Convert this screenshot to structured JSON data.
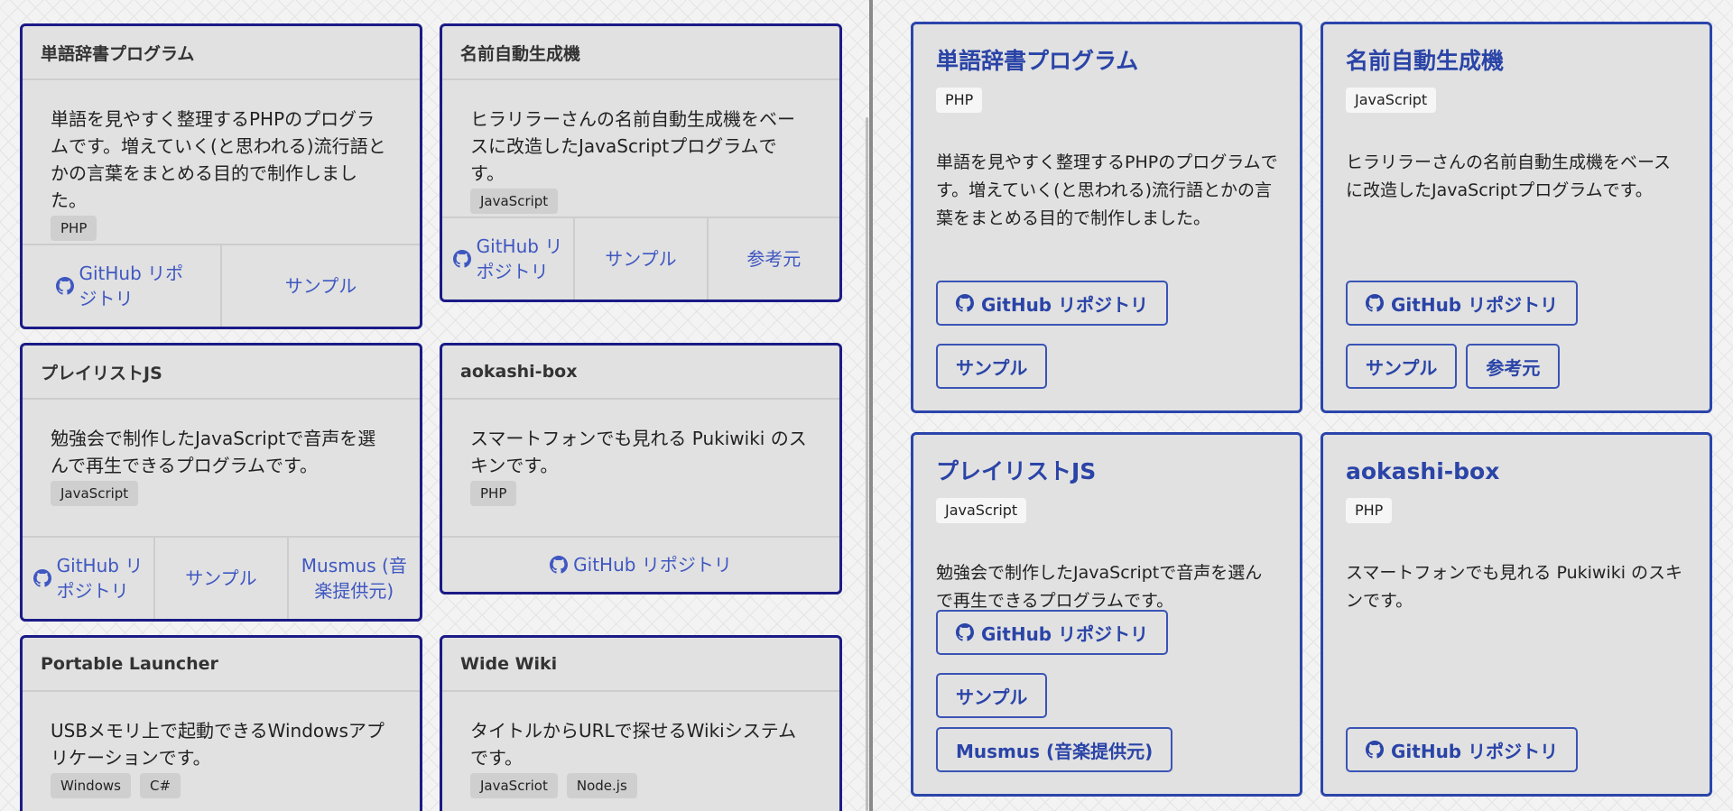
{
  "left": {
    "cards": [
      {
        "title": "単語辞書プログラム",
        "desc": "単語を見やすく整理するPHPのプログラムです。増えていく(と思われる)流行語とかの言葉をまとめる目的で制作しました。",
        "tags": [
          "PHP"
        ],
        "links": [
          "GitHub リポジトリ",
          "サンプル"
        ]
      },
      {
        "title": "名前自動生成機",
        "desc": "ヒラリラーさんの名前自動生成機をベースに改造したJavaScriptプログラムです。",
        "tags": [
          "JavaScript"
        ],
        "links": [
          "GitHub リポジトリ",
          "サンプル",
          "参考元"
        ]
      },
      {
        "title": "プレイリストJS",
        "desc": "勉強会で制作したJavaScriptで音声を選んで再生できるプログラムです。",
        "tags": [
          "JavaScript"
        ],
        "links": [
          "GitHub リポジトリ",
          "サンプル",
          "Musmus (音楽提供元)"
        ]
      },
      {
        "title": "aokashi-box",
        "desc": "スマートフォンでも見れる Pukiwiki のスキンです。",
        "tags": [
          "PHP"
        ],
        "links": [
          "GitHub リポジトリ"
        ]
      },
      {
        "title": "Portable Launcher",
        "desc": "USBメモリ上で起動できるWindowsアプリケーションです。",
        "tags": [
          "Windows",
          "C#"
        ]
      },
      {
        "title": "Wide Wiki",
        "desc": "タイトルからURLで探せるWikiシステムです。",
        "tags": [
          "JavaScriot",
          "Node.js"
        ]
      }
    ]
  },
  "right": {
    "cards": [
      {
        "title": "単語辞書プログラム",
        "tag": "PHP",
        "desc": "単語を見やすく整理するPHPのプログラムです。増えていく(と思われる)流行語とかの言葉をまとめる目的で制作しました。",
        "links": [
          "GitHub リポジトリ",
          "サンプル"
        ]
      },
      {
        "title": "名前自動生成機",
        "tag": "JavaScript",
        "desc": "ヒラリラーさんの名前自動生成機をベースに改造したJavaScriptプログラムです。",
        "links": [
          "GitHub リポジトリ",
          "サンプル",
          "参考元"
        ]
      },
      {
        "title": "プレイリストJS",
        "tag": "JavaScript",
        "desc": "勉強会で制作したJavaScriptで音声を選んで再生できるプログラムです。",
        "links": [
          "GitHub リポジトリ",
          "サンプル",
          "Musmus (音楽提供元)"
        ]
      },
      {
        "title": "aokashi-box",
        "tag": "PHP",
        "desc": "スマートフォンでも見れる Pukiwiki のスキンです。",
        "links": [
          "GitHub リポジトリ"
        ]
      }
    ]
  },
  "colors": {
    "card_border_left": "#1b1b87",
    "card_border_right": "#2b45aa",
    "link": "#3f57c1",
    "title_right": "#2a44a7",
    "card_bg": "#e1e1e1"
  },
  "icons": {
    "github": "github-icon"
  }
}
